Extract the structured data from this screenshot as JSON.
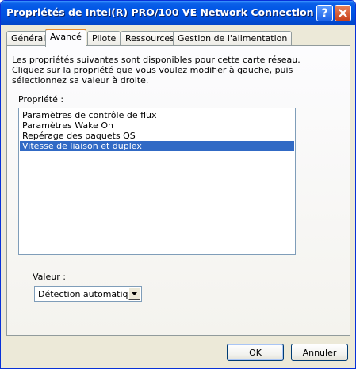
{
  "window": {
    "title": "Propriétés de Intel(R) PRO/100 VE Network Connection",
    "help_label": "?",
    "title_color": "#0055e5"
  },
  "tabs": [
    {
      "label": "Général",
      "active": false
    },
    {
      "label": "Avancé",
      "active": true
    },
    {
      "label": "Pilote",
      "active": false
    },
    {
      "label": "Ressources",
      "active": false
    },
    {
      "label": "Gestion de l'alimentation",
      "active": false
    }
  ],
  "description": "Les propriétés suivantes sont disponibles pour cette carte réseau.\nCliquez sur la propriété que vous voulez modifier à gauche, puis\nsélectionnez sa valeur à droite.",
  "property": {
    "label": "Propriété :",
    "items": [
      "Paramètres de contrôle de flux",
      "Paramètres Wake On",
      "Repérage des paquets QS",
      "Vitesse de liaison et duplex"
    ],
    "selected_index": 3,
    "selection_color": "#316ac5"
  },
  "value": {
    "label": "Valeur :",
    "selected": "Détection automatique"
  },
  "buttons": {
    "ok": "OK",
    "cancel": "Annuler"
  }
}
